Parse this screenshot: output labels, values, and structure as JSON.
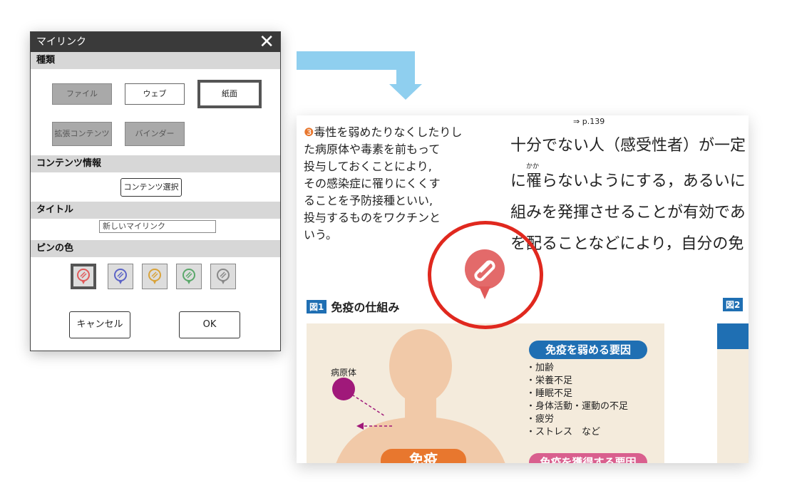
{
  "dialog": {
    "title": "マイリンク",
    "close_symbol": "✕",
    "sections": {
      "type": "種類",
      "content_info": "コンテンツ情報",
      "title": "タイトル",
      "pin_color": "ピンの色"
    },
    "type_buttons": {
      "file": "ファイル",
      "web": "ウェブ",
      "paper": "紙面",
      "extended": "拡張コンテンツ",
      "binder": "バインダー"
    },
    "content_select": "コンテンツ選択",
    "title_value": "新しいマイリンク",
    "pin_colors": [
      "#e05a5a",
      "#5b63c7",
      "#d9a33a",
      "#5aa86a",
      "#888888"
    ],
    "cancel": "キャンセル",
    "ok": "OK"
  },
  "page": {
    "ref": "⇒ p.139",
    "note_marker": "❸",
    "note_lines": [
      "毒性を弱めたりなくしたりし",
      "た病原体や毒素を前もって",
      "投与しておくことにより,",
      "その感染症に罹りにくくす",
      "ることを予防接種といい,",
      "投与するものをワクチンと",
      "いう。"
    ],
    "ruby": "かか",
    "body_lines": [
      "十分でない人（感受性者）が一定",
      "に罹らないようにする，あるいに",
      "組みを発揮させることが有効であ",
      "を配ることなどにより，自分の免"
    ],
    "fig1_num": "図1",
    "fig1_title": "免疫の仕組み",
    "fig2_num": "図2",
    "pathogen_label": "病原体",
    "weaken_title": "免疫を弱める要因",
    "weaken_factors": [
      "・加齢",
      "・栄養不足",
      "・睡眠不足",
      "・身体活動・運動の不足",
      "・疲労",
      "・ストレス　など"
    ],
    "gain_title": "免疫を獲得する要因",
    "immunity_label": "免疫"
  },
  "colors": {
    "accent_blue": "#1f6fb3",
    "highlight_red": "#e0281e",
    "pin_red": "#e05a5a",
    "orange": "#e8772e",
    "arrow_blue": "#8fcfef"
  }
}
